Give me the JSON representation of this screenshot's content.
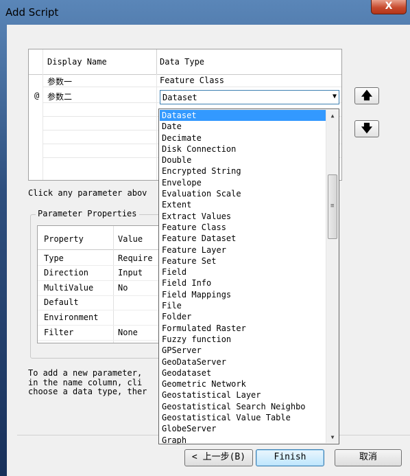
{
  "window": {
    "title": "Add Script",
    "close_glyph": "X"
  },
  "grid": {
    "columns": [
      "Display Name",
      "Data Type"
    ],
    "rows": [
      {
        "marker": "",
        "name": "参数一",
        "type": "Feature Class"
      },
      {
        "marker": "@",
        "name": "参数二",
        "type": "Dataset"
      }
    ]
  },
  "move_buttons": {
    "up_icon": "arrow-up-icon",
    "down_icon": "arrow-down-icon",
    "up_glyph": "🡅",
    "down_glyph": "🡇"
  },
  "hint": "Click any parameter abov",
  "param_props": {
    "title": "Parameter Properties",
    "columns": [
      "Property",
      "Value"
    ],
    "rows": [
      {
        "property": "Type",
        "value": "Require"
      },
      {
        "property": "Direction",
        "value": "Input"
      },
      {
        "property": "MultiValue",
        "value": "No"
      },
      {
        "property": "Default",
        "value": ""
      },
      {
        "property": "Environment",
        "value": ""
      },
      {
        "property": "Filter",
        "value": "None"
      }
    ]
  },
  "info": {
    "line1": "To add a new parameter,",
    "line2": "in the name column, cli",
    "line3": "choose a data type, ther"
  },
  "dropdown": {
    "selected": "Dataset",
    "items": [
      "Dataset",
      "Date",
      "Decimate",
      "Disk Connection",
      "Double",
      "Encrypted String",
      "Envelope",
      "Evaluation Scale",
      "Extent",
      "Extract Values",
      "Feature Class",
      "Feature Dataset",
      "Feature Layer",
      "Feature Set",
      "Field",
      "Field Info",
      "Field Mappings",
      "File",
      "Folder",
      "Formulated Raster",
      "Fuzzy function",
      "GPServer",
      "GeoDataServer",
      "Geodataset",
      "Geometric Network",
      "Geostatistical Layer",
      "Geostatistical Search Neighbo",
      "Geostatistical Value Table",
      "GlobeServer",
      "Graph"
    ]
  },
  "footer": {
    "back": "< 上一步(B)",
    "finish": "Finish",
    "cancel": "取消"
  }
}
